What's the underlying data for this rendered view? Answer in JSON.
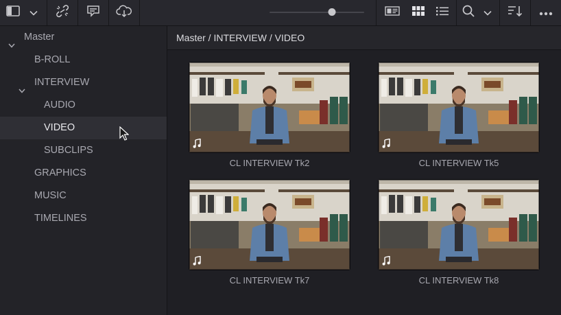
{
  "toolbar": {
    "panel_toggle_icon": "sidebar-panel-icon",
    "link_icon": "unlink-icon",
    "metadata_icon": "metadata-icon",
    "cloud_icon": "cloud-sync-icon",
    "zoom_slider_value": 0.66,
    "view_modes": [
      "metadata-view-icon",
      "thumbnail-view-icon",
      "list-view-icon"
    ],
    "search_icon": "search-icon",
    "sort_icon": "sort-icon",
    "more_icon": "more-icon"
  },
  "sidebar": {
    "items": [
      {
        "label": "Master",
        "expanded": true
      },
      {
        "label": "B-ROLL"
      },
      {
        "label": "INTERVIEW",
        "expanded": true
      },
      {
        "label": "AUDIO"
      },
      {
        "label": "VIDEO",
        "selected": true
      },
      {
        "label": "SUBCLIPS"
      },
      {
        "label": "GRAPHICS"
      },
      {
        "label": "MUSIC"
      },
      {
        "label": "TIMELINES"
      }
    ]
  },
  "main": {
    "breadcrumb": "Master / INTERVIEW / VIDEO",
    "clips": [
      {
        "name": "CL INTERVIEW Tk2"
      },
      {
        "name": "CL INTERVIEW Tk5"
      },
      {
        "name": "CL INTERVIEW Tk7"
      },
      {
        "name": "CL INTERVIEW Tk8"
      }
    ]
  },
  "colors": {
    "background": "#1f1f24",
    "toolbar": "#28282e",
    "selected_row": "#2f2f35",
    "text": "#a9a9b1"
  }
}
